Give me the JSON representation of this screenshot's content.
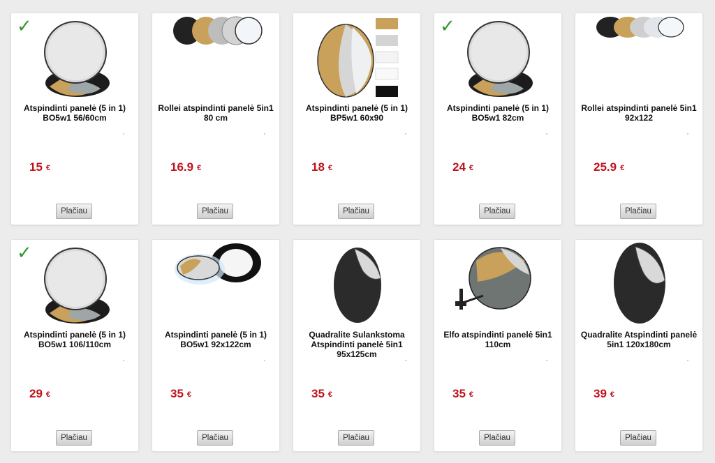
{
  "products": [
    {
      "title": "Atspindinti panelė (5 in 1) BO5w1 56/60cm",
      "price": "15",
      "currency": "€",
      "button": "Plačiau",
      "selected": true,
      "icon": "round-reflector-icon"
    },
    {
      "title": "Rollei atspindinti panelė 5in1 80 cm",
      "price": "16.9",
      "currency": "€",
      "button": "Plačiau",
      "selected": false,
      "icon": "reflector-discs-icon"
    },
    {
      "title": "Atspindinti panelė (5 in 1) BP5w1 60x90",
      "price": "18",
      "currency": "€",
      "button": "Plačiau",
      "selected": false,
      "icon": "oval-reflector-swatches-icon"
    },
    {
      "title": "Atspindinti panelė (5 in 1) BO5w1 82cm",
      "price": "24",
      "currency": "€",
      "button": "Plačiau",
      "selected": true,
      "icon": "round-reflector-icon"
    },
    {
      "title": "Rollei atspindinti panelė 5in1 92x122",
      "price": "25.9",
      "currency": "€",
      "button": "Plačiau",
      "selected": false,
      "icon": "reflector-ovals-icon"
    },
    {
      "title": "Atspindinti panelė (5 in 1) BO5w1 106/110cm",
      "price": "29",
      "currency": "€",
      "button": "Plačiau",
      "selected": true,
      "icon": "round-reflector-icon"
    },
    {
      "title": "Atspindinti panelė (5 in 1) BO5w1 92x122cm",
      "price": "35",
      "currency": "€",
      "button": "Plačiau",
      "selected": false,
      "icon": "oval-reflector-pair-icon"
    },
    {
      "title": "Quadralite Sulankstoma Atspindinti panelė 5in1 95x125cm",
      "price": "35",
      "currency": "€",
      "button": "Plačiau",
      "selected": false,
      "icon": "dark-oval-reflector-icon"
    },
    {
      "title": "Elfo atspindinti panelė 5in1 110cm",
      "price": "35",
      "currency": "€",
      "button": "Plačiau",
      "selected": false,
      "icon": "reflector-with-holder-icon"
    },
    {
      "title": "Quadralite Atspindinti panelė 5in1 120x180cm",
      "price": "39",
      "currency": "€",
      "button": "Plačiau",
      "selected": false,
      "icon": "dark-oval-reflector-icon"
    }
  ],
  "colors": {
    "price": "#c0111b",
    "check": "#2f9a2f",
    "gold": "#c9a15a",
    "silver": "#d6d6d6",
    "black": "#222222"
  }
}
